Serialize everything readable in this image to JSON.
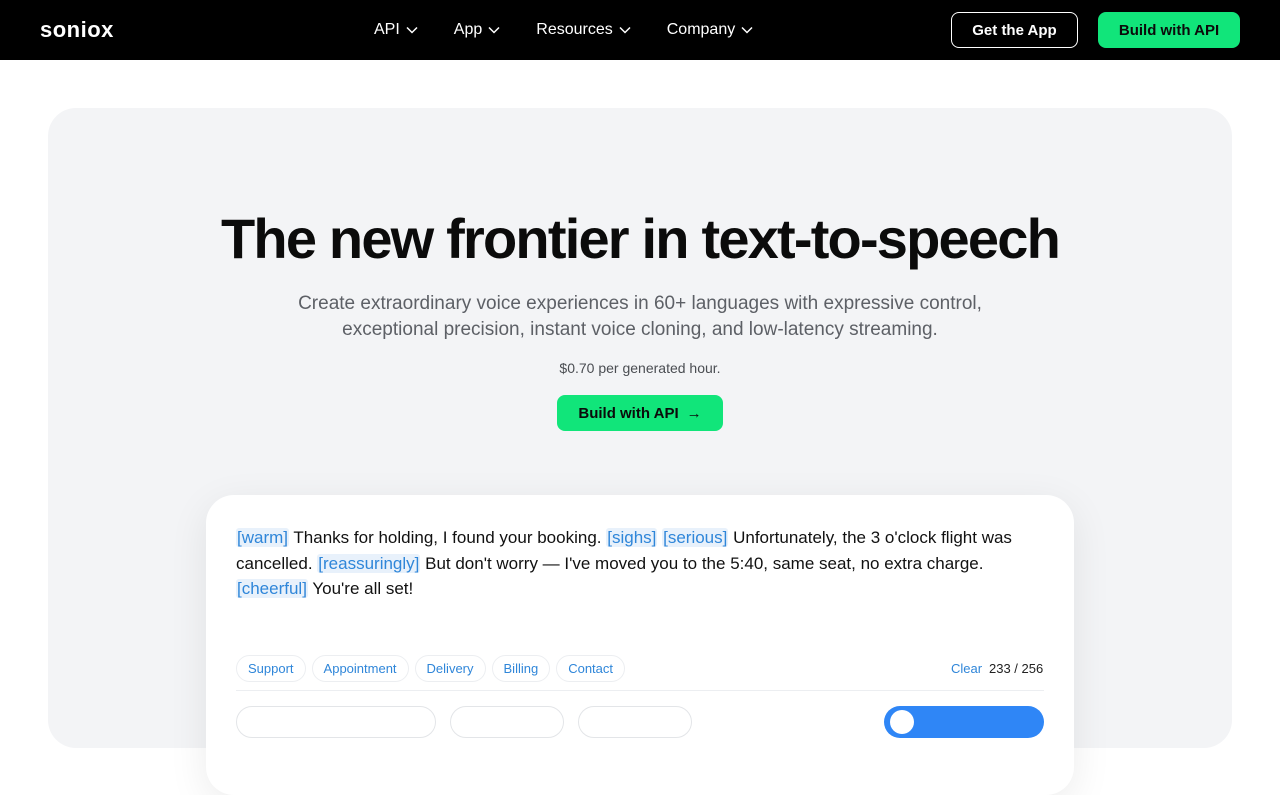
{
  "nav": {
    "logo": "soniox",
    "menu": [
      {
        "label": "API"
      },
      {
        "label": "App"
      },
      {
        "label": "Resources"
      },
      {
        "label": "Company"
      }
    ],
    "get_app_label": "Get the App",
    "build_api_label": "Build with API"
  },
  "hero": {
    "title": "The new frontier in text-to-speech",
    "subtitle_line1": "Create extraordinary voice experiences in 60+ languages with expressive control,",
    "subtitle_line2": "exceptional precision, instant voice cloning, and low-latency streaming.",
    "price": "$0.70 per generated hour.",
    "cta_label": "Build with API",
    "cta_arrow": "→"
  },
  "demo": {
    "segments": [
      {
        "tag": "[warm]",
        "text": " Thanks for holding, I found your booking. "
      },
      {
        "tag": "[sighs]",
        "text": " "
      },
      {
        "tag": "[serious]",
        "text": " Unfortunately, the 3 o'clock flight was cancelled. "
      },
      {
        "tag": "[reassuringly]",
        "text": " But don't worry — I've moved you to the 5:40, same seat, no extra charge. "
      },
      {
        "tag": "[cheerful]",
        "text": " You're all set!"
      }
    ],
    "presets": [
      "Support",
      "Appointment",
      "Delivery",
      "Billing",
      "Contact"
    ],
    "clear_label": "Clear",
    "char_count": "233 / 256"
  },
  "colors": {
    "accent_green": "#11e57a",
    "tag_blue": "#2f86d9",
    "play_blue": "#2f86f6"
  }
}
